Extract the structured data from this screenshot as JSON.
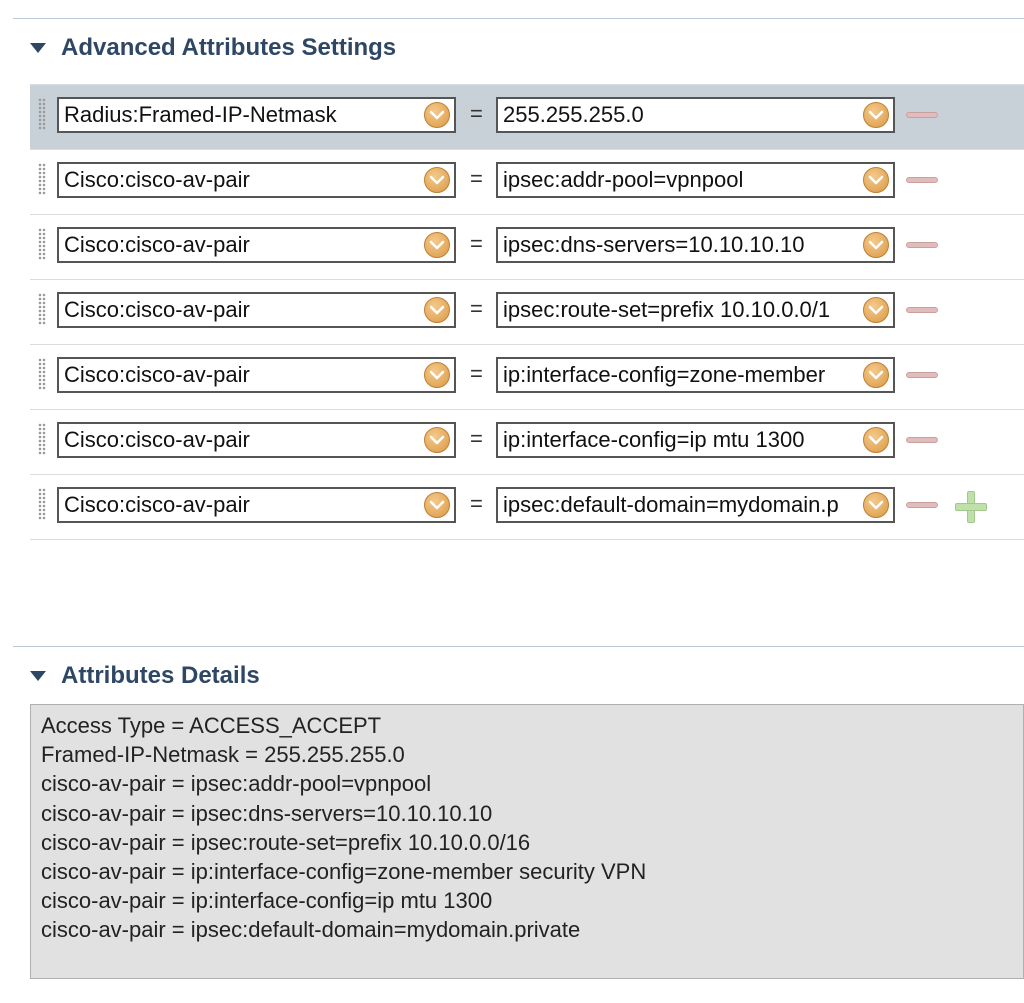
{
  "advanced": {
    "title": "Advanced Attributes Settings",
    "rows": [
      {
        "name": "Radius:Framed-IP-Netmask",
        "operator": "=",
        "value": "255.255.255.0",
        "selected": true
      },
      {
        "name": "Cisco:cisco-av-pair",
        "operator": "=",
        "value": "ipsec:addr-pool=vpnpool"
      },
      {
        "name": "Cisco:cisco-av-pair",
        "operator": "=",
        "value": "ipsec:dns-servers=10.10.10.10"
      },
      {
        "name": "Cisco:cisco-av-pair",
        "operator": "=",
        "value": "ipsec:route-set=prefix 10.10.0.0/1"
      },
      {
        "name": "Cisco:cisco-av-pair",
        "operator": "=",
        "value": "ip:interface-config=zone-member"
      },
      {
        "name": "Cisco:cisco-av-pair",
        "operator": "=",
        "value": "ip:interface-config=ip mtu 1300"
      },
      {
        "name": "Cisco:cisco-av-pair",
        "operator": "=",
        "value": "ipsec:default-domain=mydomain.p"
      }
    ]
  },
  "details": {
    "title": "Attributes Details",
    "lines": [
      "Access Type = ACCESS_ACCEPT",
      "Framed-IP-Netmask = 255.255.255.0",
      "cisco-av-pair = ipsec:addr-pool=vpnpool",
      "cisco-av-pair = ipsec:dns-servers=10.10.10.10",
      "cisco-av-pair = ipsec:route-set=prefix 10.10.0.0/16",
      "cisco-av-pair = ip:interface-config=zone-member security VPN",
      "cisco-av-pair = ip:interface-config=ip mtu 1300",
      "cisco-av-pair = ipsec:default-domain=mydomain.private"
    ]
  },
  "colors": {
    "header_text": "#2e4764",
    "selected_row": "#c8d0d8",
    "dropdown_button": "#d99a47",
    "remove_button": "#e2bcbc",
    "add_button": "#bfe0a8",
    "details_bg": "#e1e1e1"
  },
  "icons": {
    "collapse": "triangle-down-icon",
    "dropdown": "chevron-down-icon",
    "remove": "minus-icon",
    "add": "plus-icon",
    "drag": "drag-handle-icon"
  }
}
